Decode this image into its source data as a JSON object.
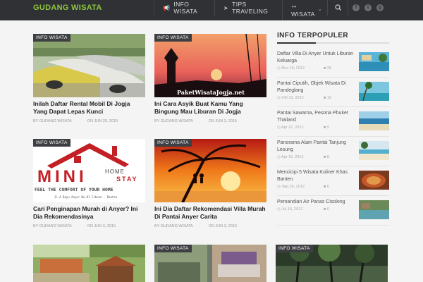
{
  "site": {
    "name": "GUDANG WISATA"
  },
  "nav": [
    {
      "label": "INFO WISATA",
      "icon": "megaphone-icon"
    },
    {
      "label": "TIPS TRAVELING",
      "icon": "paper-plane-icon"
    },
    {
      "label": "WISATA",
      "icon": "paw-icon",
      "has_dropdown": true
    }
  ],
  "social": [
    "facebook-icon",
    "twitter-icon",
    "google-plus-icon"
  ],
  "colors": {
    "accent": "#8dc63f",
    "topbar": "#2f3134",
    "tag": "#3d3f42"
  },
  "posts": [
    {
      "category": "INFO WISATA",
      "title": "Inilah Daftar Rental Mobil Di Jogja Yang Dapat Lepas Kunci",
      "author": "BY GUDANG WISATA",
      "date": "ON JUN 20, 2015",
      "image": "rental cars"
    },
    {
      "category": "INFO WISATA",
      "title": "Ini Cara Asyik Buat Kamu Yang Bingung Mau Liburan Di Jogja",
      "author": "BY GUDANG WISATA",
      "date": "ON JUN 3, 2015",
      "image": "jogja sunset",
      "watermark": "PaketWisataJogja.net"
    },
    {
      "category": "INFO WISATA",
      "title": "Cari Penginapan Murah di Anyer? Ini Dia Rekomendasinya",
      "author": "BY GUDANG WISATA",
      "date": "ON JUN 3, 2015",
      "image": "mini home stay logo",
      "logo_text": {
        "main": "MINI",
        "home": "HOME",
        "stay": "STAY",
        "slogan": "FEEL THE COMFORT OF YOUR HOME",
        "address": "Jl.A Bayu Anyer No.01 Cibone - Banten"
      }
    },
    {
      "category": "INFO WISATA",
      "title": "Ini Dia Daftar Rekomendasi Villa Murah Di Pantai Anyer Carita",
      "author": "BY GUDANG WISATA",
      "date": "ON JUN 3, 2015",
      "image": "beach sunset couple"
    },
    {
      "category": "",
      "title": "",
      "author": "",
      "date": "",
      "image": "resort garden"
    },
    {
      "category": "INFO WISATA",
      "title": "",
      "author": "",
      "date": "",
      "image": "villa room"
    },
    {
      "category": "INFO WISATA",
      "title": "",
      "author": "",
      "date": "",
      "image": "tropical trees"
    }
  ],
  "sidebar": {
    "title": "INFO TERPOPULER",
    "items": [
      {
        "title": "Daftar Villa Di Anyer Untuk Liburan Keluarga",
        "date": "Nov 16, 2012",
        "views": "26"
      },
      {
        "title": "Pantai Ciputih, Objek Wisata Di Pandeglang",
        "date": "Okt 12, 2012",
        "views": "10"
      },
      {
        "title": "Pantai Sawarna, Pesona Phuket Thailand",
        "date": "Apr 22, 2012",
        "views": "9"
      },
      {
        "title": "Panorama Alam Pantai Tanjung Lesung",
        "date": "Apr 16, 2012",
        "views": "8"
      },
      {
        "title": "Mencicipi 5 Wisata Kuliner Khas Banten",
        "date": "Sep 26, 2012",
        "views": "6"
      },
      {
        "title": "Pemandian Air Panas Cisolong",
        "date": "Jul 16, 2012",
        "views": "6"
      }
    ]
  }
}
